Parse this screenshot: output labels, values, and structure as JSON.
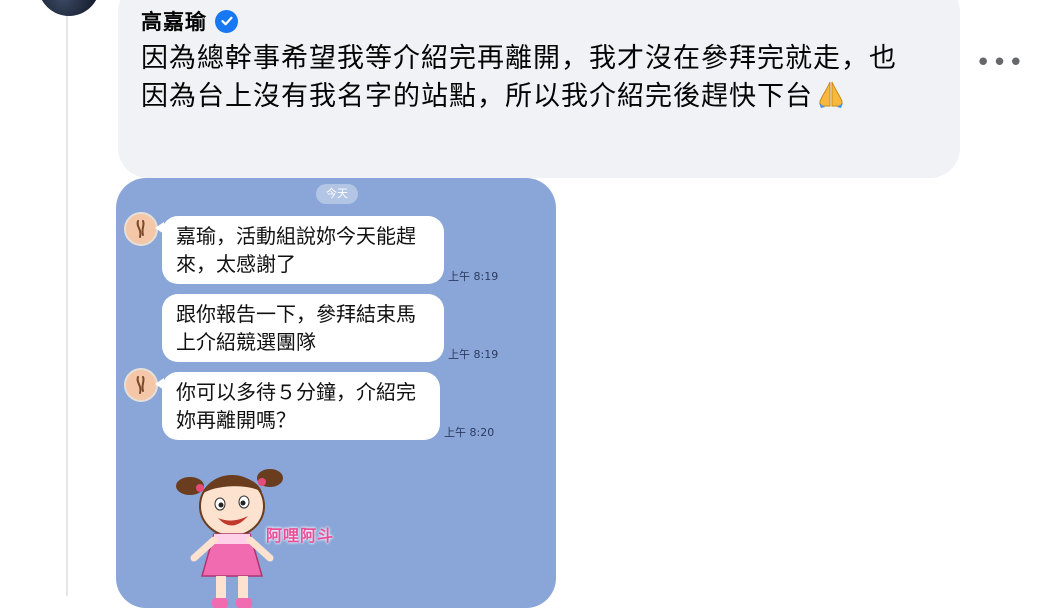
{
  "comment": {
    "author": "高嘉瑜",
    "text": "因為總幹事希望我等介紹完再離開，我才沒在參拜完就走，也因為台上沒有我名字的站點，所以我介紹完後趕快下台",
    "emoji": "🙏",
    "more_label": "•••"
  },
  "chat": {
    "date_label": "今天",
    "messages": [
      {
        "text": "嘉瑜，活動組說妳今天能趕來，太感謝了",
        "time": "上午 8:19"
      },
      {
        "text": "跟你報告一下，參拜結束馬上介紹競選團隊",
        "time": "上午 8:19"
      },
      {
        "text": "你可以多待５分鐘，介紹完妳再離開嗎？",
        "time": "上午 8:20"
      }
    ],
    "sticker_caption": "阿哩阿斗"
  },
  "colors": {
    "chat_background": "#8aa6d8",
    "comment_background": "#f0f2f5",
    "verified_blue": "#1877f2"
  }
}
